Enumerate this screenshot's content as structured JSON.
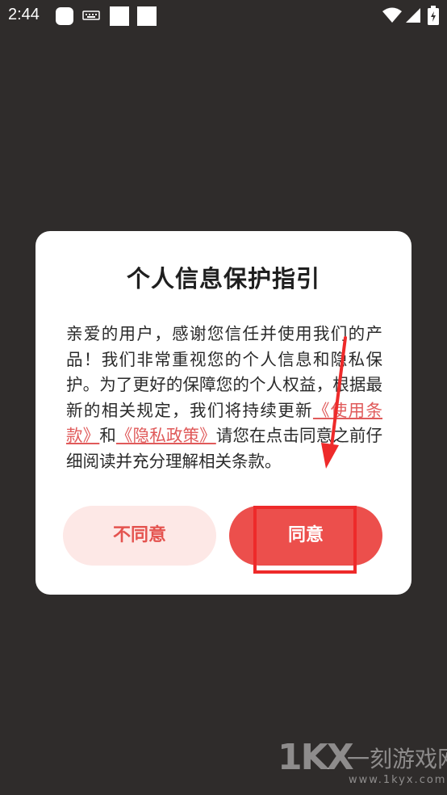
{
  "status_bar": {
    "time": "2:44",
    "icons": [
      "app-icon",
      "keyboard-icon",
      "square-icon",
      "square-icon",
      "wifi-icon",
      "signal-icon",
      "battery-icon"
    ]
  },
  "dialog": {
    "title": "个人信息保护指引",
    "body": {
      "part1": "亲爱的用户，感谢您信任并使用我们的产品！我们非常重视您的个人信息和隐私保护。为了更好的保障您的个人权益，根据最新的相关规定，我们将持续更新",
      "link_terms": "《使用条款》",
      "part2": "和",
      "link_privacy": "《隐私政策》",
      "part3": "请您在点击同意之前仔细阅读并充分理解相关条款。"
    },
    "disagree_label": "不同意",
    "agree_label": "同意"
  },
  "colors": {
    "accent": "#ec4f4c",
    "accent_light": "#fde8e6",
    "link": "#e05a5a",
    "annotation": "#ee2a2a",
    "overlay": "#2f2c2b"
  },
  "watermark": {
    "logo": "1KX",
    "brand": "一刻游戏网",
    "url": "www.1kyx.com"
  }
}
